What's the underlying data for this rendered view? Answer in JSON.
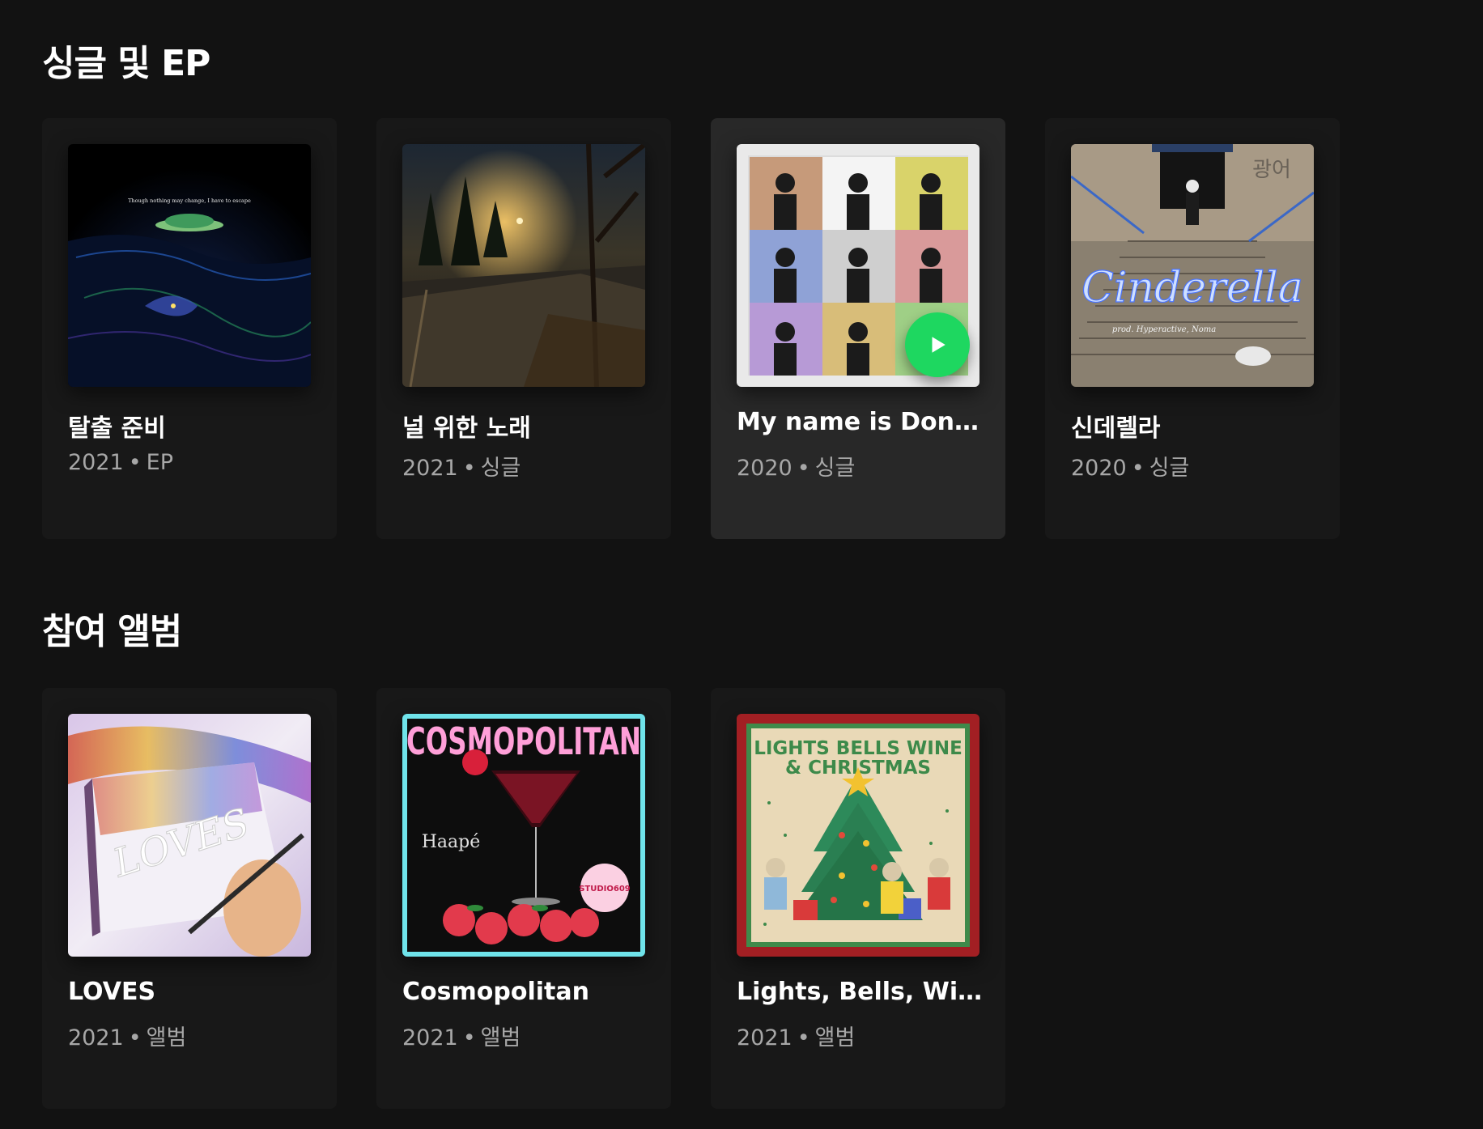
{
  "sections": [
    {
      "title": "싱글 및 EP",
      "cards": [
        {
          "title": "탈출 준비",
          "year": "2021",
          "sep": "•",
          "type": "EP",
          "cover_text": "Though nothing may change, I have to escape"
        },
        {
          "title": "널 위한 노래",
          "year": "2021",
          "sep": "•",
          "type": "싱글"
        },
        {
          "title": "My name is Dong...",
          "year": "2020",
          "sep": "•",
          "type": "싱글"
        },
        {
          "title": "신데렐라",
          "year": "2020",
          "sep": "•",
          "type": "싱글",
          "cover_text": "Cinderella",
          "cover_subtext": "prod. Hyperactive, Noma",
          "cover_sign": "광어"
        }
      ]
    },
    {
      "title": "참여 앨범",
      "cards": [
        {
          "title": "LOVES",
          "year": "2021",
          "sep": "•",
          "type": "앨범",
          "cover_text": "LOVES"
        },
        {
          "title": "Cosmopolitan",
          "year": "2021",
          "sep": "•",
          "type": "앨범",
          "cover_text": "COSMOPOLITAN",
          "cover_subtext": "Haapé",
          "cover_badge": "STUDIO609"
        },
        {
          "title": "Lights, Bells, Wine...",
          "year": "2021",
          "sep": "•",
          "type": "앨범",
          "cover_text_1": "LIGHTS BELLS WINE",
          "cover_text_2": "& CHRISTMAS"
        }
      ]
    }
  ],
  "colors": {
    "background": "#121212",
    "card": "#181818",
    "card_hover": "#282828",
    "accent": "#1ed760",
    "meta_text": "#a7a7a7"
  },
  "play_icon": "play-icon"
}
